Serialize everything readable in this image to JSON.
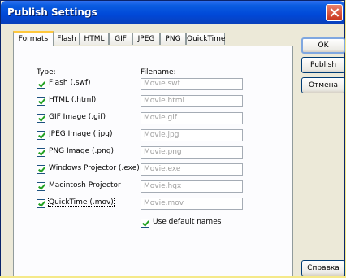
{
  "window": {
    "title": "Publish Settings"
  },
  "tabs": [
    {
      "label": "Formats"
    },
    {
      "label": "Flash"
    },
    {
      "label": "HTML"
    },
    {
      "label": "GIF"
    },
    {
      "label": "JPEG"
    },
    {
      "label": "PNG"
    },
    {
      "label": "QuickTime"
    }
  ],
  "formats": {
    "type_header": "Type:",
    "filename_header": "Filename:",
    "rows": [
      {
        "label": "Flash  (.swf)",
        "filename": "Movie.swf",
        "checked": true
      },
      {
        "label": "HTML  (.html)",
        "filename": "Movie.html",
        "checked": true
      },
      {
        "label": "GIF Image (.gif)",
        "filename": "Movie.gif",
        "checked": true
      },
      {
        "label": "JPEG Image (.jpg)",
        "filename": "Movie.jpg",
        "checked": true
      },
      {
        "label": "PNG Image (.png)",
        "filename": "Movie.png",
        "checked": true
      },
      {
        "label": "Windows Projector (.exe)",
        "filename": "Movie.exe",
        "checked": true
      },
      {
        "label": "Macintosh Projector",
        "filename": "Movie.hqx",
        "checked": true
      },
      {
        "label": "QuickTime (.mov)",
        "filename": "Movie.mov",
        "checked": true
      }
    ],
    "use_default_names": {
      "label": "Use default names",
      "checked": true
    }
  },
  "buttons": {
    "ok": "OK",
    "publish": "Publish",
    "cancel": "Отмена",
    "help": "Справка"
  },
  "colors": {
    "titlebar": "#0048d8",
    "tab_highlight": "#ffc83c",
    "check": "#21a121"
  }
}
